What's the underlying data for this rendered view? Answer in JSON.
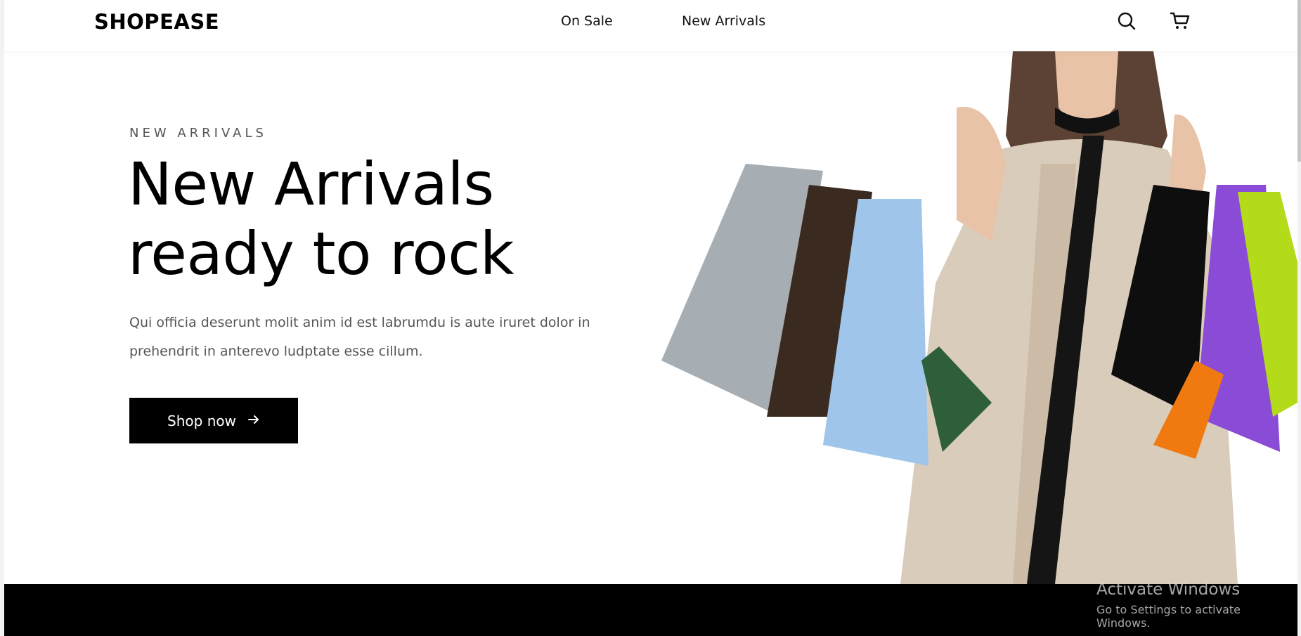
{
  "header": {
    "logo": "SHOPEASE",
    "nav": [
      "On Sale",
      "New Arrivals"
    ],
    "icons": [
      "search-icon",
      "cart-icon"
    ]
  },
  "hero": {
    "eyebrow": "NEW ARRIVALS",
    "headline_line1": "New Arrivals",
    "headline_line2": "ready to rock",
    "subtext": "Qui officia deserunt molit anim id est labrumdu is aute iruret dolor in prehendrit in anterevo ludptate esse cillum.",
    "cta_label": "Shop now",
    "cta_icon": "arrow-right-icon"
  },
  "watermark": {
    "title": "Activate Windows",
    "subtitle": "Go to Settings to activate Windows."
  },
  "colors": {
    "primary": "#000000",
    "text_muted": "#555555",
    "background": "#ffffff"
  }
}
